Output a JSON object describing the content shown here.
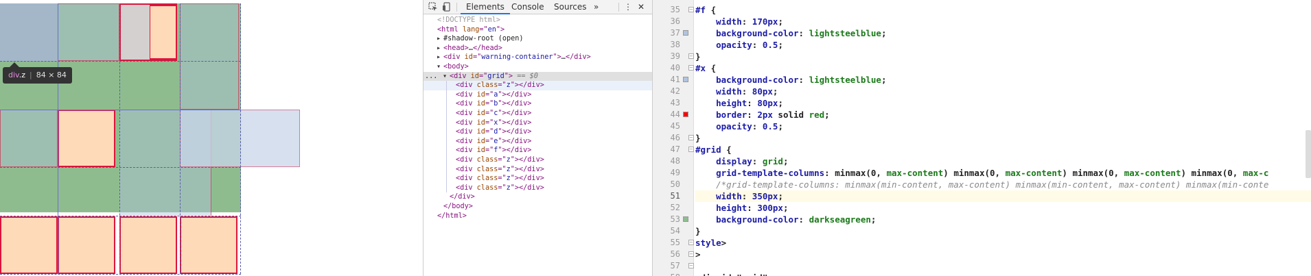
{
  "tooltip": {
    "tag": "div",
    "class": ".z",
    "dims": "84 × 84"
  },
  "devtools": {
    "tabs": [
      "Elements",
      "Console",
      "Sources"
    ],
    "more": "»",
    "menu": "⋮",
    "close": "✕"
  },
  "dom": [
    {
      "indent": 0,
      "tri": "",
      "parts": [
        {
          "c": "t-cmt",
          "t": "<!DOCTYPE html>"
        }
      ]
    },
    {
      "indent": 0,
      "tri": "",
      "parts": [
        {
          "c": "t-tag",
          "t": "<html "
        },
        {
          "c": "t-attr",
          "t": "lang"
        },
        {
          "c": "t-tag",
          "t": "=\""
        },
        {
          "c": "t-val",
          "t": "en"
        },
        {
          "c": "t-tag",
          "t": "\">"
        }
      ]
    },
    {
      "indent": 1,
      "tri": "▶",
      "parts": [
        {
          "c": "t-txt",
          "t": "#shadow-root (open)"
        }
      ]
    },
    {
      "indent": 1,
      "tri": "▶",
      "parts": [
        {
          "c": "t-tag",
          "t": "<head>"
        },
        {
          "c": "t-txt",
          "t": "…"
        },
        {
          "c": "t-tag",
          "t": "</head>"
        }
      ]
    },
    {
      "indent": 1,
      "tri": "▶",
      "parts": [
        {
          "c": "t-tag",
          "t": "<div "
        },
        {
          "c": "t-attr",
          "t": "id"
        },
        {
          "c": "t-tag",
          "t": "=\""
        },
        {
          "c": "t-val",
          "t": "warning-container"
        },
        {
          "c": "t-tag",
          "t": "\">"
        },
        {
          "c": "t-txt",
          "t": "…"
        },
        {
          "c": "t-tag",
          "t": "</div>"
        }
      ]
    },
    {
      "indent": 1,
      "tri": "▼",
      "parts": [
        {
          "c": "t-tag",
          "t": "<body>"
        }
      ]
    },
    {
      "indent": 2,
      "tri": "▼",
      "selected": true,
      "prefix": "...",
      "parts": [
        {
          "c": "t-tag",
          "t": "<div "
        },
        {
          "c": "t-attr",
          "t": "id"
        },
        {
          "c": "t-tag",
          "t": "=\""
        },
        {
          "c": "t-val",
          "t": "grid"
        },
        {
          "c": "t-tag",
          "t": "\">"
        },
        {
          "c": "t-dollar",
          "t": " == $0"
        }
      ]
    },
    {
      "indent": 3,
      "tri": "",
      "hover": true,
      "parts": [
        {
          "c": "t-tag",
          "t": "<div "
        },
        {
          "c": "t-attr",
          "t": "class"
        },
        {
          "c": "t-tag",
          "t": "=\""
        },
        {
          "c": "t-val",
          "t": "z"
        },
        {
          "c": "t-tag",
          "t": "\"></div>"
        }
      ]
    },
    {
      "indent": 3,
      "tri": "",
      "parts": [
        {
          "c": "t-tag",
          "t": "<div "
        },
        {
          "c": "t-attr",
          "t": "id"
        },
        {
          "c": "t-tag",
          "t": "=\""
        },
        {
          "c": "t-val",
          "t": "a"
        },
        {
          "c": "t-tag",
          "t": "\"></div>"
        }
      ]
    },
    {
      "indent": 3,
      "tri": "",
      "parts": [
        {
          "c": "t-tag",
          "t": "<div "
        },
        {
          "c": "t-attr",
          "t": "id"
        },
        {
          "c": "t-tag",
          "t": "=\""
        },
        {
          "c": "t-val",
          "t": "b"
        },
        {
          "c": "t-tag",
          "t": "\"></div>"
        }
      ]
    },
    {
      "indent": 3,
      "tri": "",
      "parts": [
        {
          "c": "t-tag",
          "t": "<div "
        },
        {
          "c": "t-attr",
          "t": "id"
        },
        {
          "c": "t-tag",
          "t": "=\""
        },
        {
          "c": "t-val",
          "t": "c"
        },
        {
          "c": "t-tag",
          "t": "\"></div>"
        }
      ]
    },
    {
      "indent": 3,
      "tri": "",
      "parts": [
        {
          "c": "t-tag",
          "t": "<div "
        },
        {
          "c": "t-attr",
          "t": "id"
        },
        {
          "c": "t-tag",
          "t": "=\""
        },
        {
          "c": "t-val",
          "t": "x"
        },
        {
          "c": "t-tag",
          "t": "\"></div>"
        }
      ]
    },
    {
      "indent": 3,
      "tri": "",
      "parts": [
        {
          "c": "t-tag",
          "t": "<div "
        },
        {
          "c": "t-attr",
          "t": "id"
        },
        {
          "c": "t-tag",
          "t": "=\""
        },
        {
          "c": "t-val",
          "t": "d"
        },
        {
          "c": "t-tag",
          "t": "\"></div>"
        }
      ]
    },
    {
      "indent": 3,
      "tri": "",
      "parts": [
        {
          "c": "t-tag",
          "t": "<div "
        },
        {
          "c": "t-attr",
          "t": "id"
        },
        {
          "c": "t-tag",
          "t": "=\""
        },
        {
          "c": "t-val",
          "t": "e"
        },
        {
          "c": "t-tag",
          "t": "\"></div>"
        }
      ]
    },
    {
      "indent": 3,
      "tri": "",
      "parts": [
        {
          "c": "t-tag",
          "t": "<div "
        },
        {
          "c": "t-attr",
          "t": "id"
        },
        {
          "c": "t-tag",
          "t": "=\""
        },
        {
          "c": "t-val",
          "t": "f"
        },
        {
          "c": "t-tag",
          "t": "\"></div>"
        }
      ]
    },
    {
      "indent": 3,
      "tri": "",
      "parts": [
        {
          "c": "t-tag",
          "t": "<div "
        },
        {
          "c": "t-attr",
          "t": "class"
        },
        {
          "c": "t-tag",
          "t": "=\""
        },
        {
          "c": "t-val",
          "t": "z"
        },
        {
          "c": "t-tag",
          "t": "\"></div>"
        }
      ]
    },
    {
      "indent": 3,
      "tri": "",
      "parts": [
        {
          "c": "t-tag",
          "t": "<div "
        },
        {
          "c": "t-attr",
          "t": "class"
        },
        {
          "c": "t-tag",
          "t": "=\""
        },
        {
          "c": "t-val",
          "t": "z"
        },
        {
          "c": "t-tag",
          "t": "\"></div>"
        }
      ]
    },
    {
      "indent": 3,
      "tri": "",
      "parts": [
        {
          "c": "t-tag",
          "t": "<div "
        },
        {
          "c": "t-attr",
          "t": "class"
        },
        {
          "c": "t-tag",
          "t": "=\""
        },
        {
          "c": "t-val",
          "t": "z"
        },
        {
          "c": "t-tag",
          "t": "\"></div>"
        }
      ]
    },
    {
      "indent": 3,
      "tri": "",
      "parts": [
        {
          "c": "t-tag",
          "t": "<div "
        },
        {
          "c": "t-attr",
          "t": "class"
        },
        {
          "c": "t-tag",
          "t": "=\""
        },
        {
          "c": "t-val",
          "t": "z"
        },
        {
          "c": "t-tag",
          "t": "\"></div>"
        }
      ]
    },
    {
      "indent": 2,
      "tri": "",
      "parts": [
        {
          "c": "t-tag",
          "t": "</div>"
        }
      ]
    },
    {
      "indent": 1,
      "tri": "",
      "parts": [
        {
          "c": "t-tag",
          "t": "</body>"
        }
      ]
    },
    {
      "indent": 0,
      "tri": "",
      "parts": [
        {
          "c": "t-tag",
          "t": "</html>"
        }
      ]
    }
  ],
  "source": {
    "current_line": 51,
    "lines": [
      {
        "n": 35,
        "fold": "-",
        "parts": [
          {
            "c": "c-sel",
            "t": "#f"
          },
          {
            "c": "c-punc",
            "t": " {"
          }
        ]
      },
      {
        "n": 36,
        "parts": [
          {
            "c": "c-prop",
            "t": "    width"
          },
          {
            "c": "c-punc",
            "t": ": "
          },
          {
            "c": "c-num",
            "t": "170px"
          },
          {
            "c": "c-punc",
            "t": ";"
          }
        ]
      },
      {
        "n": 37,
        "swatch": "#b0c4de",
        "parts": [
          {
            "c": "c-prop",
            "t": "    background-color"
          },
          {
            "c": "c-punc",
            "t": ": "
          },
          {
            "c": "c-kw",
            "t": "lightsteelblue"
          },
          {
            "c": "c-punc",
            "t": ";"
          }
        ]
      },
      {
        "n": 38,
        "parts": [
          {
            "c": "c-prop",
            "t": "    opacity"
          },
          {
            "c": "c-punc",
            "t": ": "
          },
          {
            "c": "c-num",
            "t": "0.5"
          },
          {
            "c": "c-punc",
            "t": ";"
          }
        ]
      },
      {
        "n": 39,
        "fold": "-",
        "parts": [
          {
            "c": "c-punc",
            "t": "}"
          }
        ]
      },
      {
        "n": 40,
        "fold": "-",
        "parts": [
          {
            "c": "c-sel",
            "t": "#x"
          },
          {
            "c": "c-punc",
            "t": " {"
          }
        ]
      },
      {
        "n": 41,
        "swatch": "#b0c4de",
        "parts": [
          {
            "c": "c-prop",
            "t": "    background-color"
          },
          {
            "c": "c-punc",
            "t": ": "
          },
          {
            "c": "c-kw",
            "t": "lightsteelblue"
          },
          {
            "c": "c-punc",
            "t": ";"
          }
        ]
      },
      {
        "n": 42,
        "parts": [
          {
            "c": "c-prop",
            "t": "    width"
          },
          {
            "c": "c-punc",
            "t": ": "
          },
          {
            "c": "c-num",
            "t": "80px"
          },
          {
            "c": "c-punc",
            "t": ";"
          }
        ]
      },
      {
        "n": 43,
        "parts": [
          {
            "c": "c-prop",
            "t": "    height"
          },
          {
            "c": "c-punc",
            "t": ": "
          },
          {
            "c": "c-num",
            "t": "80px"
          },
          {
            "c": "c-punc",
            "t": ";"
          }
        ]
      },
      {
        "n": 44,
        "swatch": "#ff0000",
        "parts": [
          {
            "c": "c-prop",
            "t": "    border"
          },
          {
            "c": "c-punc",
            "t": ": "
          },
          {
            "c": "c-num",
            "t": "2px"
          },
          {
            "c": "c-val",
            "t": " solid "
          },
          {
            "c": "c-kw",
            "t": "red"
          },
          {
            "c": "c-punc",
            "t": ";"
          }
        ]
      },
      {
        "n": 45,
        "parts": [
          {
            "c": "c-prop",
            "t": "    opacity"
          },
          {
            "c": "c-punc",
            "t": ": "
          },
          {
            "c": "c-num",
            "t": "0.5"
          },
          {
            "c": "c-punc",
            "t": ";"
          }
        ]
      },
      {
        "n": 46,
        "fold": "-",
        "parts": [
          {
            "c": "c-punc",
            "t": "}"
          }
        ]
      },
      {
        "n": 47,
        "fold": "-",
        "parts": [
          {
            "c": "c-sel",
            "t": "#grid"
          },
          {
            "c": "c-punc",
            "t": " {"
          }
        ]
      },
      {
        "n": 48,
        "parts": [
          {
            "c": "c-prop",
            "t": "    display"
          },
          {
            "c": "c-punc",
            "t": ": "
          },
          {
            "c": "c-kw",
            "t": "grid"
          },
          {
            "c": "c-punc",
            "t": ";"
          }
        ]
      },
      {
        "n": 49,
        "parts": [
          {
            "c": "c-prop",
            "t": "    grid-template-columns"
          },
          {
            "c": "c-punc",
            "t": ": "
          },
          {
            "c": "c-val",
            "t": "minmax(0, "
          },
          {
            "c": "c-kw",
            "t": "max-content"
          },
          {
            "c": "c-val",
            "t": ") minmax(0, "
          },
          {
            "c": "c-kw",
            "t": "max-content"
          },
          {
            "c": "c-val",
            "t": ") minmax(0, "
          },
          {
            "c": "c-kw",
            "t": "max-content"
          },
          {
            "c": "c-val",
            "t": ") minmax(0, "
          },
          {
            "c": "c-kw",
            "t": "max-c"
          }
        ]
      },
      {
        "n": 50,
        "parts": [
          {
            "c": "c-cmt",
            "t": "    /*grid-template-columns: minmax(min-content, max-content) minmax(min-content, max-content) minmax(min-conte"
          }
        ]
      },
      {
        "n": 51,
        "parts": [
          {
            "c": "c-prop",
            "t": "    width"
          },
          {
            "c": "c-punc",
            "t": ": "
          },
          {
            "c": "c-num",
            "t": "350px"
          },
          {
            "c": "c-punc",
            "t": ";"
          }
        ]
      },
      {
        "n": 52,
        "parts": [
          {
            "c": "c-prop",
            "t": "    height"
          },
          {
            "c": "c-punc",
            "t": ": "
          },
          {
            "c": "c-num",
            "t": "300px"
          },
          {
            "c": "c-punc",
            "t": ";"
          }
        ]
      },
      {
        "n": 53,
        "swatch": "#8fbc8f",
        "parts": [
          {
            "c": "c-prop",
            "t": "    background-color"
          },
          {
            "c": "c-punc",
            "t": ": "
          },
          {
            "c": "c-kw",
            "t": "darkseagreen"
          },
          {
            "c": "c-punc",
            "t": ";"
          }
        ]
      },
      {
        "n": 54,
        "parts": [
          {
            "c": "c-punc",
            "t": "}"
          }
        ]
      },
      {
        "n": 55,
        "fold": "-",
        "parts": [
          {
            "c": "c-sel",
            "t": "style"
          },
          {
            "c": "c-punc",
            "t": ">"
          }
        ]
      },
      {
        "n": 56,
        "fold": "-",
        "parts": [
          {
            "c": "c-punc",
            "t": ">"
          }
        ]
      },
      {
        "n": 57,
        "fold": "-",
        "parts": [
          {
            "c": "c-punc",
            "t": ""
          }
        ]
      },
      {
        "n": 58,
        "parts": [
          {
            "c": "c-punc",
            "t": "<div id=\"grid\">"
          }
        ]
      }
    ]
  },
  "colors": {
    "grid_bg": "#8fbc8f",
    "z_bg": "#ffdab9",
    "z_border": "#dc143c",
    "steelblue": "#b0c4de"
  }
}
